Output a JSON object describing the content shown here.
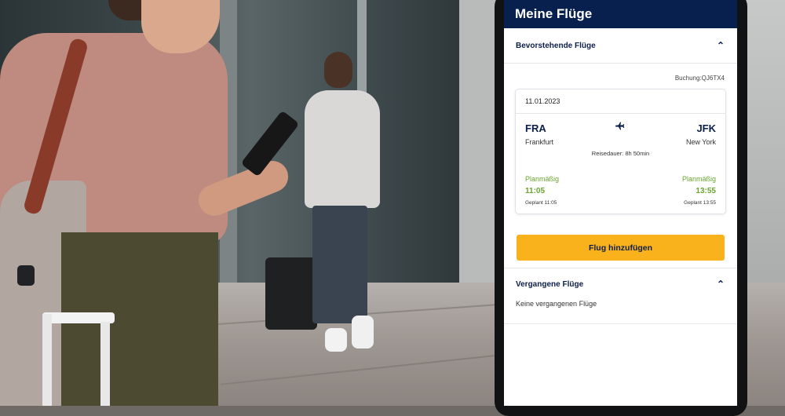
{
  "app": {
    "title": "Meine Flüge"
  },
  "upcoming": {
    "heading": "Bevorstehende Flüge",
    "chevron": "chevron-up-icon",
    "booking_ref": "Buchung:QJ6TX4",
    "flight": {
      "date": "11.01.2023",
      "origin_code": "FRA",
      "origin_city": "Frankfurt",
      "destination_code": "JFK",
      "destination_city": "New York",
      "duration": "Reisedauer: 8h 50min",
      "departure_status": "Planmäßig",
      "departure_time": "11:05",
      "departure_planned": "Geplant 11:05",
      "arrival_status": "Planmäßig",
      "arrival_time": "13:55",
      "arrival_planned": "Geplant 13:55"
    },
    "add_button": "Flug hinzufügen"
  },
  "past": {
    "heading": "Vergangene Flüge",
    "chevron": "chevron-up-icon",
    "empty_text": "Keine vergangenen Flüge"
  },
  "colors": {
    "header_bg": "#08204e",
    "accent_button": "#f9b11c",
    "status_green": "#6aa531",
    "text_navy": "#0c1f4a"
  }
}
